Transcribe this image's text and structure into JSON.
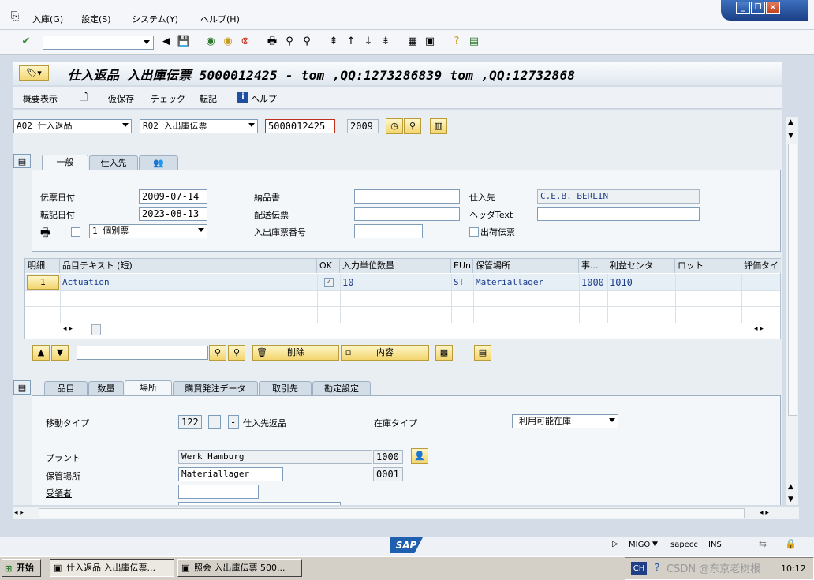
{
  "menu": {
    "items": [
      "入庫(G)",
      "設定(S)",
      "システム(Y)",
      "ヘルプ(H)"
    ]
  },
  "window": {
    "title": "仕入返品 入出庫伝票 5000012425 - tom ,QQ:1273286839 tom ,QQ:12732868"
  },
  "app_toolbar": {
    "overview": "概要表示",
    "hold": "仮保存",
    "check": "チェック",
    "post": "転記",
    "help": "ヘルプ"
  },
  "header": {
    "action": "A02 仕入返品",
    "ref_doc": "R02 入出庫伝票",
    "doc_number": "5000012425",
    "year": "2009"
  },
  "tabs_top": [
    "一般",
    "仕入先",
    ""
  ],
  "general": {
    "doc_date_label": "伝票日付",
    "doc_date": "2009-07-14",
    "posting_date_label": "転記日付",
    "posting_date": "2023-08-13",
    "print_option": "1 個別票",
    "delivery_note_label": "納品書",
    "bill_of_lading_label": "配送伝票",
    "gr_slip_label": "入出庫票番号",
    "vendor_label": "仕入先",
    "vendor_value": "C.E.B. BERLIN",
    "header_text_label": "ヘッダText",
    "shipping_doc_label": "出荷伝票"
  },
  "grid": {
    "headers": [
      "明細",
      "品目テキスト (短)",
      "OK",
      "入力単位数量",
      "EUn",
      "保管場所",
      "事...",
      "利益センタ",
      "ロット",
      "評価タイ"
    ],
    "row": {
      "line": "1",
      "text": "Actuation",
      "qty": "10",
      "unit": "ST",
      "sloc": "Materiallager",
      "col7": "1000",
      "profit_center": "1010"
    }
  },
  "grid_toolbar": {
    "delete": "削除",
    "content": "内容"
  },
  "tabs_bottom": [
    "品目",
    "数量",
    "場所",
    "購買発注データ",
    "取引先",
    "勘定設定"
  ],
  "location": {
    "movement_type_label": "移動タイプ",
    "movement_type": "122",
    "movement_sign": "-",
    "movement_desc": "仕入先返品",
    "stock_type_label": "在庫タイプ",
    "stock_type": "利用可能在庫",
    "plant_label": "プラント",
    "plant_name": "Werk Hamburg",
    "plant_code": "1000",
    "sloc_label": "保管場所",
    "sloc_name": "Materiallager",
    "sloc_code": "0001",
    "recipient_label": "受領者"
  },
  "statusbar": {
    "transaction": "MIGO",
    "system": "sapecc",
    "mode": "INS"
  },
  "taskbar": {
    "start": "开始",
    "task1": "仕入返品 入出庫伝票...",
    "task2": "照会 入出庫伝票 500...",
    "lang": "CH",
    "time": "10:12",
    "watermark": "CSDN @东京老树根"
  },
  "colors": {
    "accent": "#1f4fa2",
    "button_yellow": "#f3d56e",
    "panel": "#f4f7fa"
  }
}
